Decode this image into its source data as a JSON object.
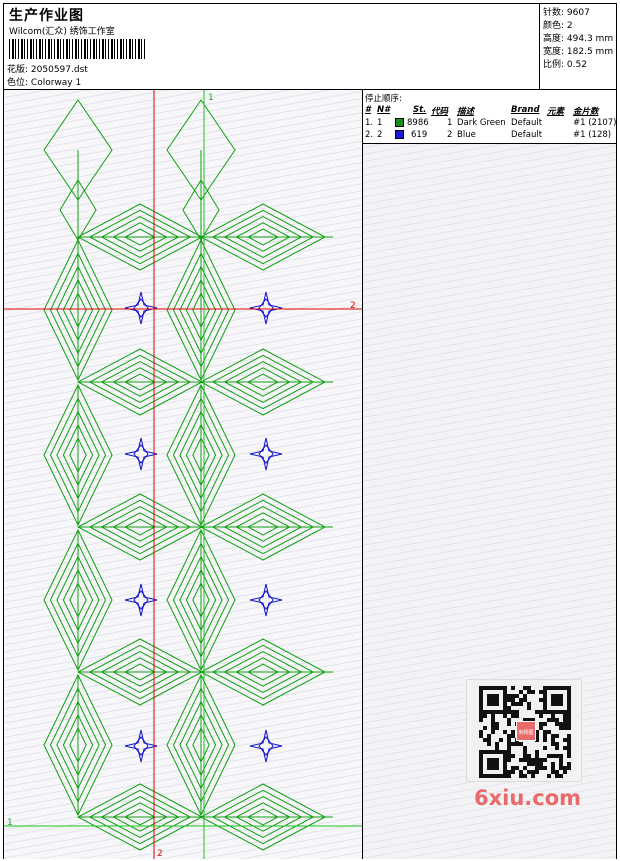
{
  "header": {
    "title": "生产作业图",
    "studio": "Wilcom(汇众) 绣饰工作室",
    "design_label": "花版:",
    "design_value": "2050597.dst",
    "colorway_label": "色位:",
    "colorway_value": "Colorway 1"
  },
  "stats": {
    "stitches_label": "针数:",
    "stitches_value": "9607",
    "colors_label": "颜色:",
    "colors_value": "2",
    "height_label": "高度:",
    "height_value": "494.3 mm",
    "width_label": "宽度:",
    "width_value": "182.5 mm",
    "scale_label": "比例:",
    "scale_value": "0.52"
  },
  "stop_sequence": {
    "label": "停止顺序:",
    "headers": [
      "#",
      "N#",
      "St.",
      "代码",
      "描述",
      "Brand",
      "元素",
      "金片数"
    ],
    "rows": [
      {
        "index": "1.",
        "needle": "1",
        "code": "8986",
        "num": "1",
        "desc": "Dark Green",
        "brand": "Default",
        "sequin": "#1 (2107)",
        "color": "#1a8a1a"
      },
      {
        "index": "2.",
        "needle": "2",
        "code": "619",
        "num": "2",
        "desc": "Blue",
        "brand": "Default",
        "sequin": "#1 (128)",
        "color": "#1a1ad6"
      }
    ]
  },
  "canvas": {
    "markers": {
      "v1": "1",
      "h2": "2",
      "h1": "1",
      "v2": "2"
    },
    "green": "#10a010",
    "blue": "#1010cc",
    "red": "#e00000"
  },
  "watermark": "6xiu.com",
  "qr_badge": "刺绣图"
}
